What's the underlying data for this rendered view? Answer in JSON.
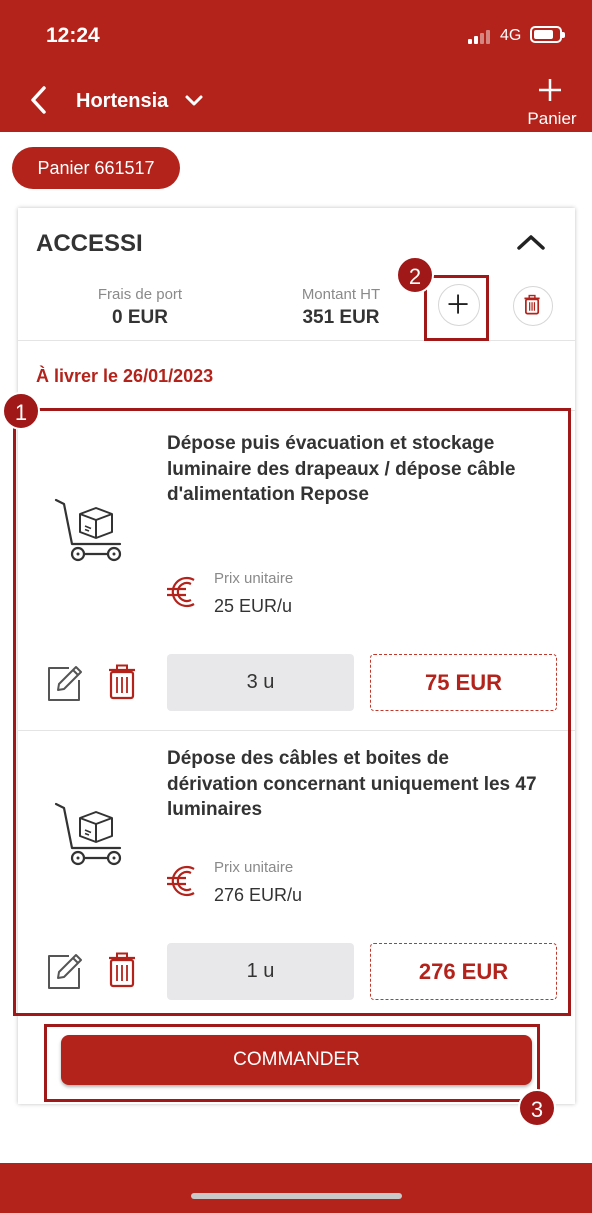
{
  "status": {
    "time": "12:24",
    "network": "4G"
  },
  "header": {
    "title": "Hortensia",
    "cart_action_label": "Panier"
  },
  "cart_pill": "Panier 661517",
  "section": {
    "title": "ACCESSI",
    "shipping_label": "Frais de port",
    "shipping_value": "0 EUR",
    "amount_label": "Montant HT",
    "amount_value": "351 EUR",
    "delivery": "À livrer le 26/01/2023"
  },
  "items": [
    {
      "title": "Dépose puis évacuation et stockage luminaire des drapeaux / dépose câble d'alimentation Repose",
      "unit_price_label": "Prix unitaire",
      "unit_price": "25 EUR/u",
      "quantity": "3 u",
      "total": "75 EUR"
    },
    {
      "title": "Dépose des câbles et boites de dérivation concernant uniquement les 47 luminaires",
      "unit_price_label": "Prix unitaire",
      "unit_price": "276 EUR/u",
      "quantity": "1 u",
      "total": "276 EUR"
    }
  ],
  "order_button": "COMMANDER",
  "annotations": [
    "1",
    "2",
    "3"
  ],
  "colors": {
    "brand": "#b3231b",
    "highlight": "#a01818"
  }
}
